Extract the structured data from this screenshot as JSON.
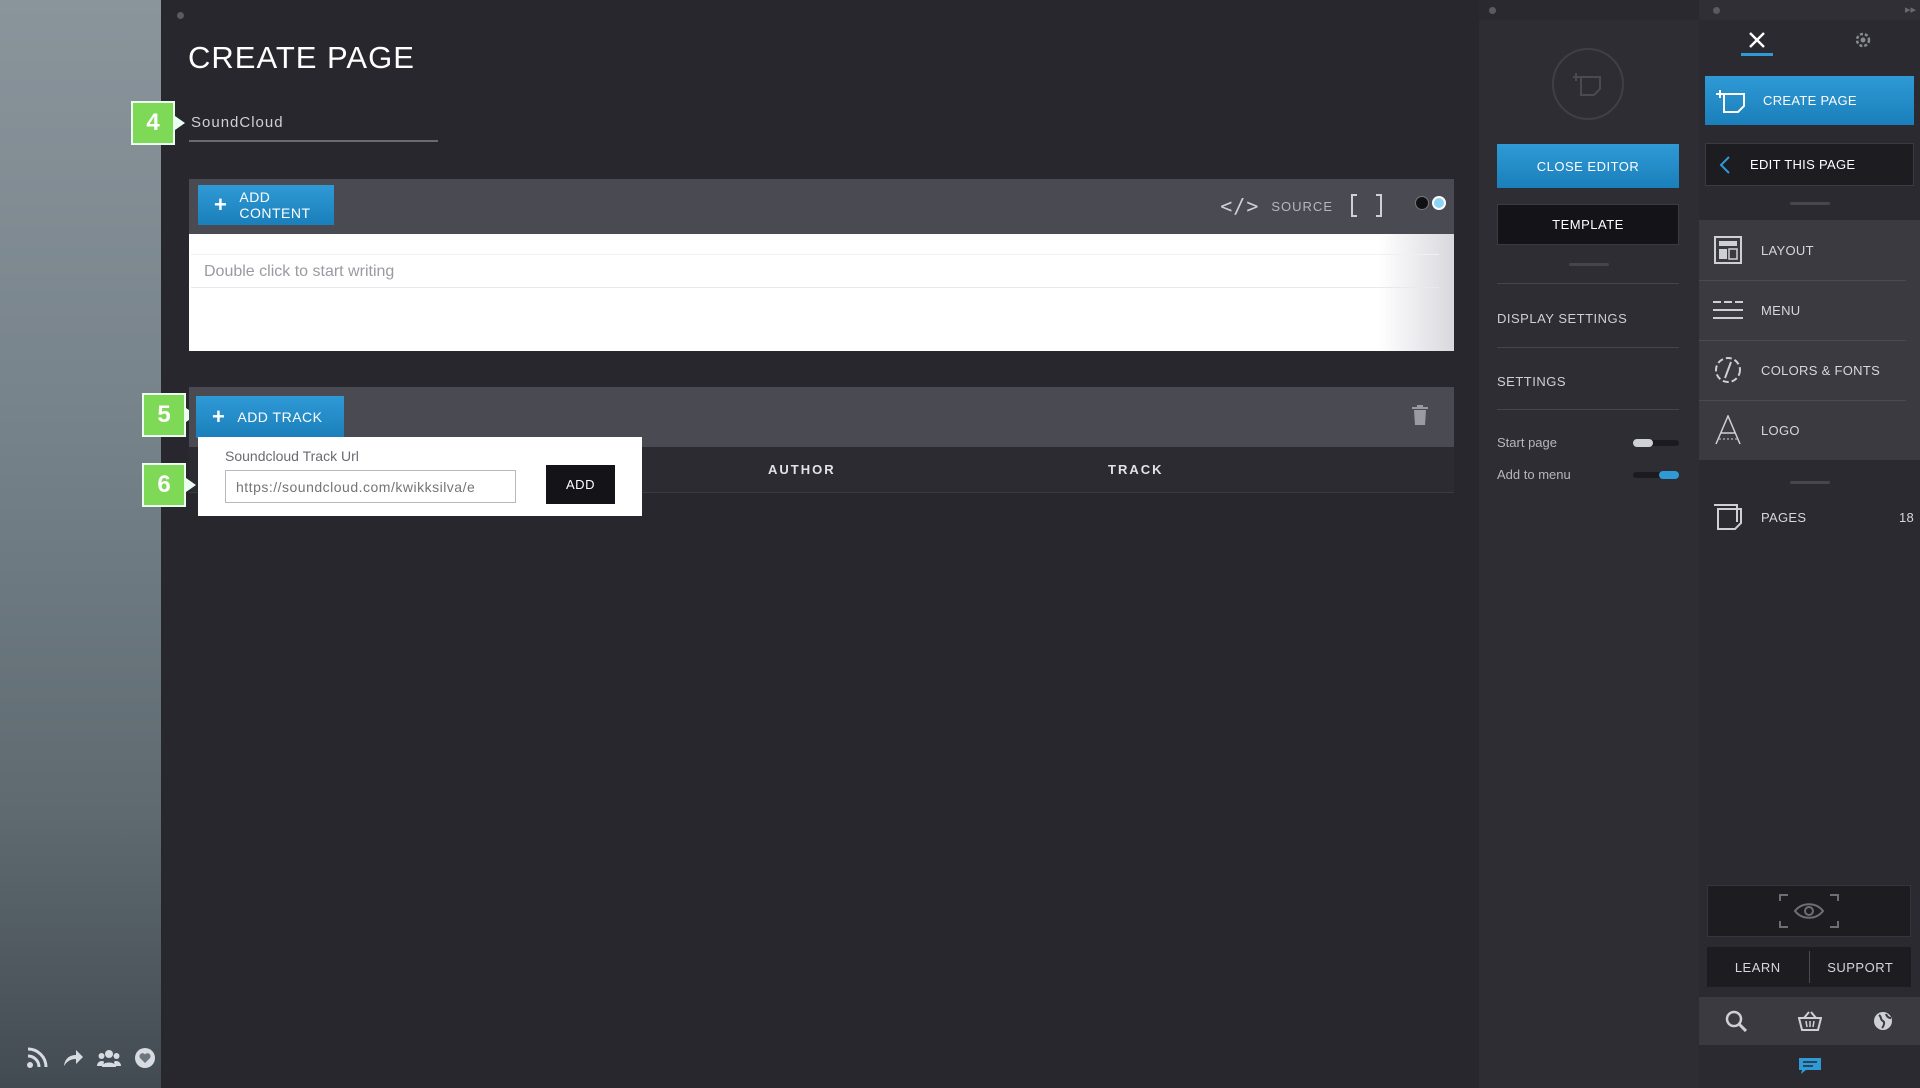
{
  "main": {
    "title": "CREATE PAGE",
    "page_name_value": "SoundCloud",
    "add_content_label": "ADD CONTENT",
    "source_label": "SOURCE",
    "editor_placeholder": "Double click to start writing",
    "add_track_label": "ADD TRACK",
    "columns": [
      "AUTHOR",
      "TRACK"
    ],
    "popup": {
      "label": "Soundcloud Track Url",
      "url_placeholder": "https://soundcloud.com/kwikksilva/e",
      "add_label": "ADD"
    },
    "badges": [
      "4",
      "5",
      "6"
    ],
    "badge_color": "#7ed957"
  },
  "settings_panel": {
    "close_editor_label": "CLOSE EDITOR",
    "template_label": "TEMPLATE",
    "display_settings_label": "DISPLAY SETTINGS",
    "settings_label": "SETTINGS",
    "start_page_label": "Start page",
    "add_to_menu_label": "Add to menu",
    "start_page_on": false,
    "add_to_menu_on": true
  },
  "sidebar": {
    "tabs": [
      "tools-icon",
      "gear-icon"
    ],
    "create_page_label": "CREATE PAGE",
    "edit_this_page_label": "EDIT THIS PAGE",
    "items": [
      {
        "label": "LAYOUT",
        "icon": "layout-icon"
      },
      {
        "label": "MENU",
        "icon": "menu-icon"
      },
      {
        "label": "COLORS & FONTS",
        "icon": "colors-fonts-icon"
      },
      {
        "label": "LOGO",
        "icon": "logo-icon"
      }
    ],
    "pages_label": "PAGES",
    "pages_count": "18",
    "learn_label": "LEARN",
    "support_label": "SUPPORT",
    "accent_color": "#2f9ad6"
  },
  "social_icons": [
    "rss-icon",
    "share-icon",
    "community-icon",
    "heart-icon"
  ]
}
